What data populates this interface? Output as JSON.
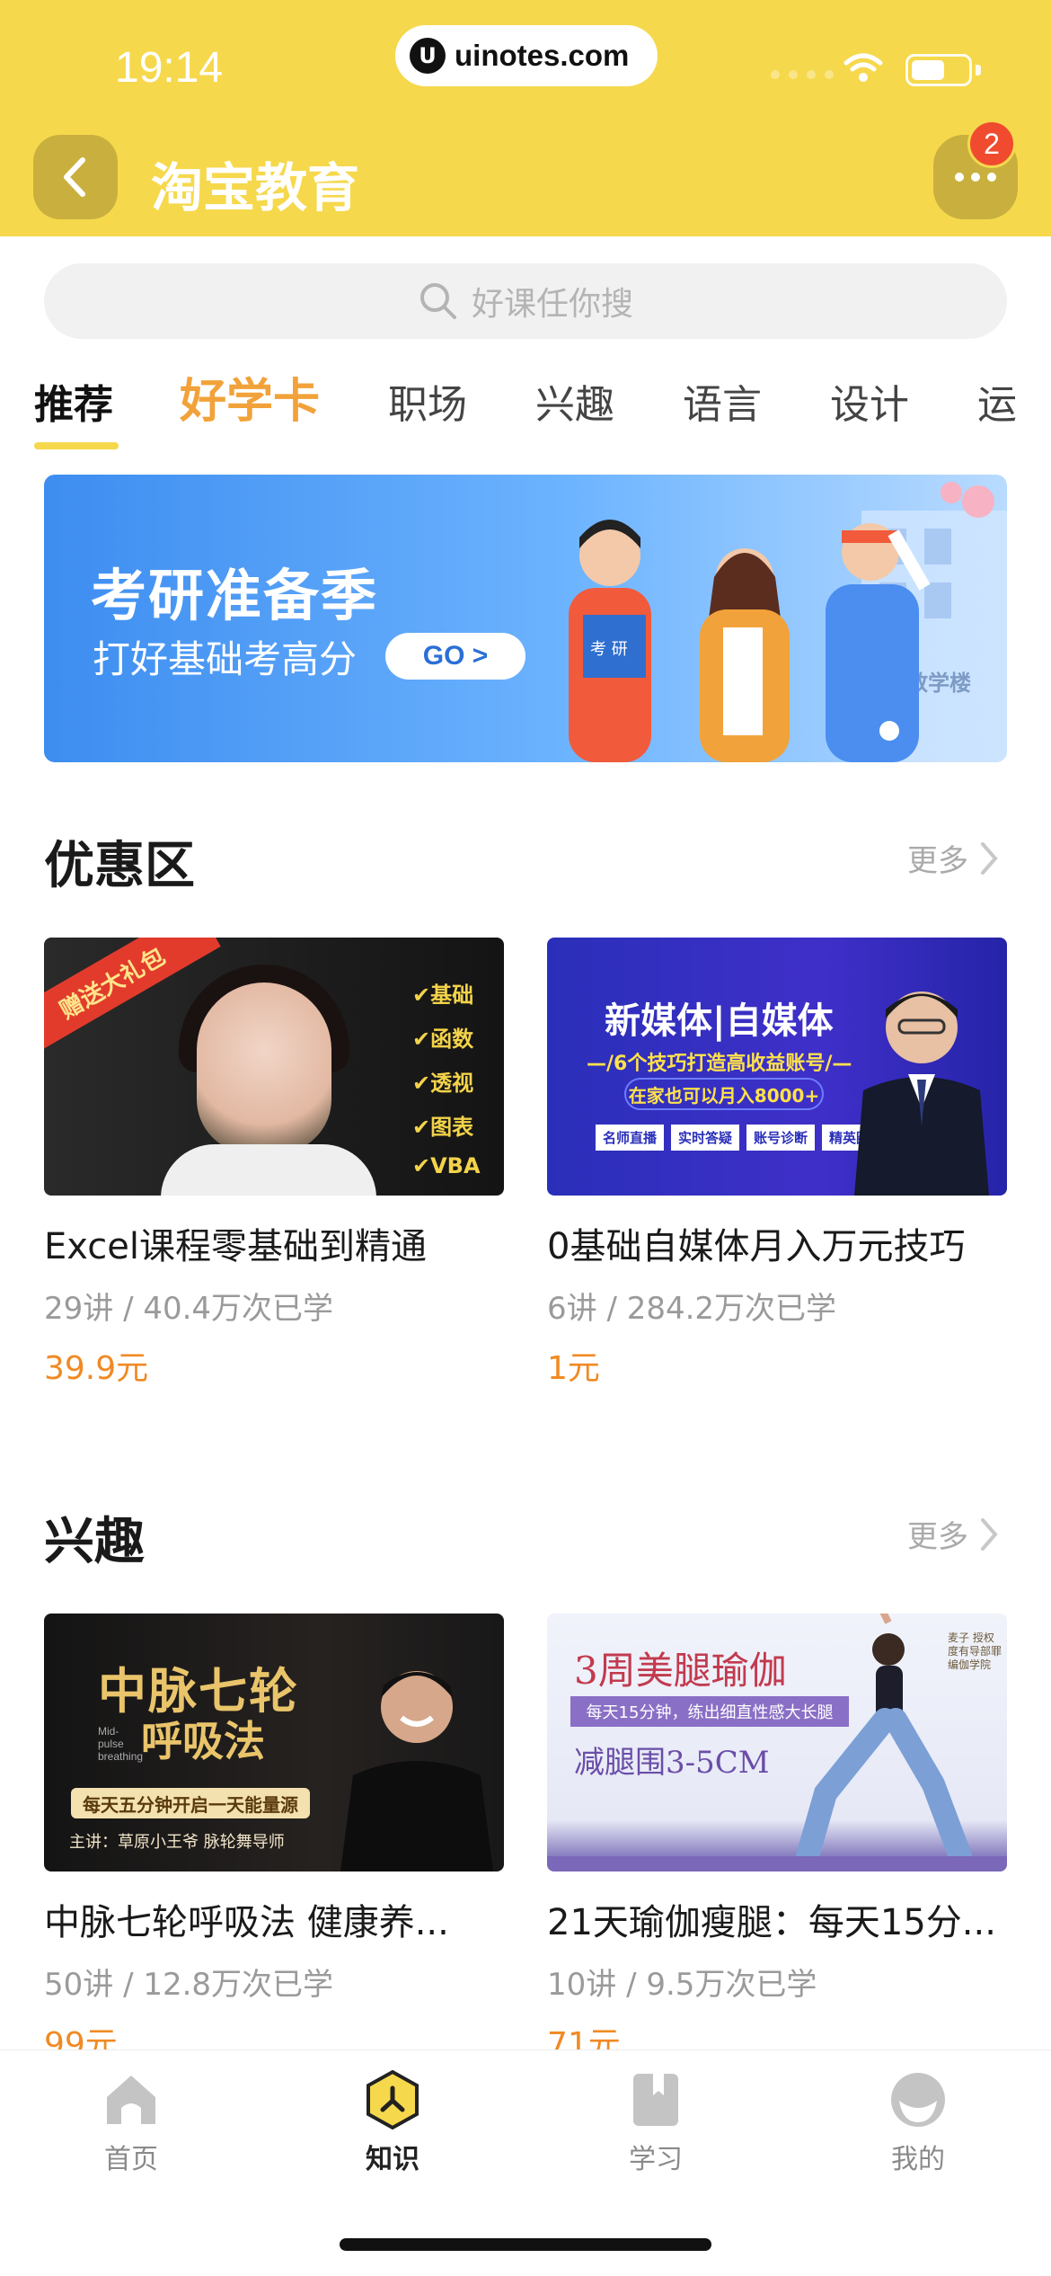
{
  "status_bar": {
    "time": "19:14",
    "url": "uinotes.com"
  },
  "header": {
    "title": "淘宝教育",
    "badge_count": "2"
  },
  "search": {
    "placeholder": "好课任你搜"
  },
  "tabs": [
    "推荐",
    "好学卡",
    "职场",
    "兴趣",
    "语言",
    "设计",
    "运"
  ],
  "banner": {
    "title": "考研准备季",
    "subtitle": "打好基础考高分",
    "cta": "GO",
    "book_text": "考 研",
    "building_text": "教学楼"
  },
  "sections": [
    {
      "title": "优惠区",
      "more": "更多",
      "courses": [
        {
          "title": "Excel课程零基础到精通",
          "meta": "29讲 / 40.4万次已学",
          "price": "39.9元",
          "thumb": {
            "ribbon": "赠送大礼包",
            "checks": [
              "基础",
              "函数",
              "透视",
              "图表",
              "VBA"
            ]
          }
        },
        {
          "title": "0基础自媒体月入万元技巧",
          "meta": "6讲 / 284.2万次已学",
          "price": "1元",
          "thumb": {
            "headline": "新媒体|自媒体",
            "sub": "—/6个技巧打造高收益账号/—",
            "pill": "在家也可以月入8000+",
            "tags": [
              "名师直播",
              "实时答疑",
              "账号诊断",
              "精英圈子"
            ]
          }
        }
      ]
    },
    {
      "title": "兴趣",
      "more": "更多",
      "courses": [
        {
          "title": "中脉七轮呼吸法 健康养...",
          "meta": "50讲 / 12.8万次已学",
          "price": "99元",
          "thumb": {
            "line1": "中脉七轮",
            "line2": "呼吸法",
            "en": "Mid-pulse breathing",
            "pill": "每天五分钟开启一天能量源",
            "host": "主讲：草原小王爷    脉轮舞导师"
          }
        },
        {
          "title": "21天瑜伽瘦腿：每天15分...",
          "meta": "10讲 / 9.5万次已学",
          "price": "71元",
          "thumb": {
            "headline": "3周美腿瑜伽",
            "sub": "每天15分钟，练出细直性感大长腿",
            "size": "减腿围3-5CM",
            "side": "麦子 授权度有导部罪编伽学院"
          }
        }
      ]
    }
  ],
  "tabbar": [
    {
      "label": "首页",
      "icon": "home-icon"
    },
    {
      "label": "知识",
      "icon": "knowledge-icon",
      "active": true
    },
    {
      "label": "学习",
      "icon": "book-icon"
    },
    {
      "label": "我的",
      "icon": "profile-icon"
    }
  ],
  "colors": {
    "header": "#f6d84c",
    "accent": "#f2a23a",
    "price": "#f08a24"
  }
}
